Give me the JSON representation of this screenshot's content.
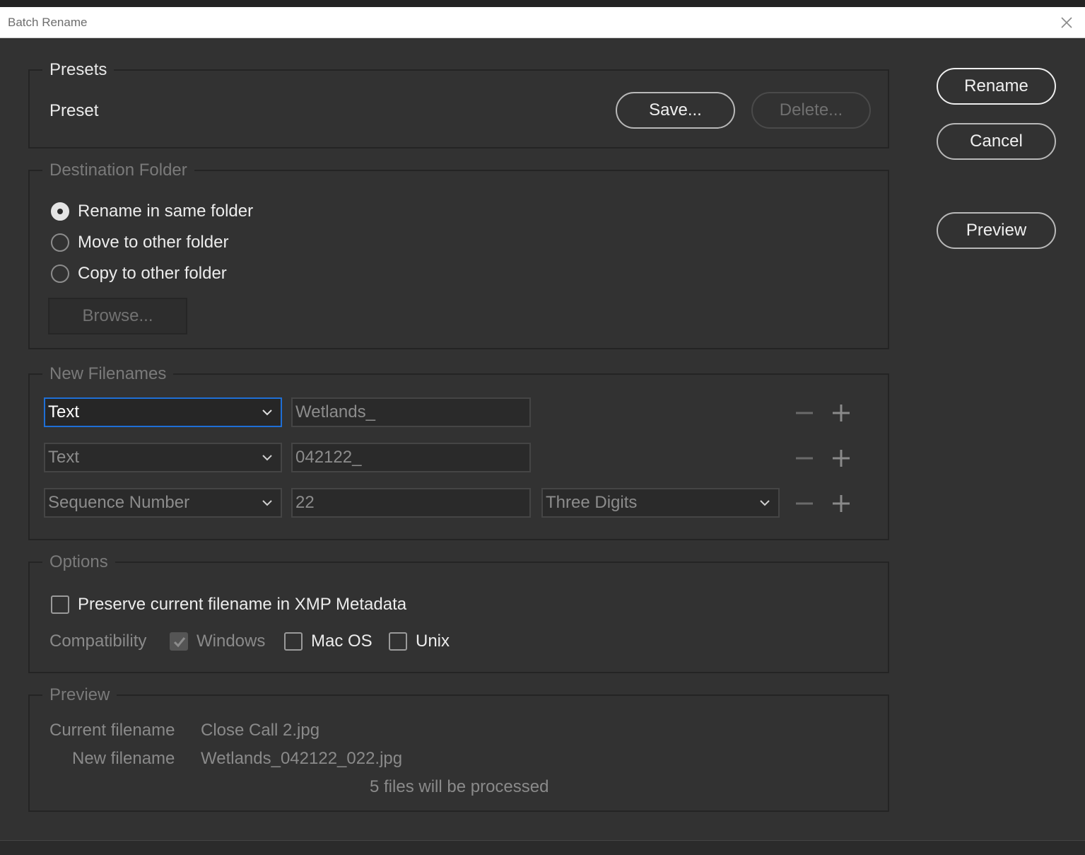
{
  "window": {
    "title": "Batch Rename"
  },
  "actions": {
    "rename": "Rename",
    "cancel": "Cancel",
    "preview": "Preview"
  },
  "presets": {
    "legend": "Presets",
    "preset_label": "Preset",
    "save": "Save...",
    "delete": "Delete..."
  },
  "destination": {
    "legend": "Destination Folder",
    "options": [
      "Rename in same folder",
      "Move to other folder",
      "Copy to other folder"
    ],
    "selected": "Rename in same folder",
    "browse": "Browse..."
  },
  "new_filenames": {
    "legend": "New Filenames",
    "rows": [
      {
        "type": "Text",
        "value": "Wetlands_"
      },
      {
        "type": "Text",
        "value": "042122_"
      },
      {
        "type": "Sequence Number",
        "value": "22",
        "format": "Three Digits"
      }
    ]
  },
  "options": {
    "legend": "Options",
    "preserve_label": "Preserve current filename in XMP Metadata",
    "preserve_checked": false,
    "compatibility_label": "Compatibility",
    "windows": "Windows",
    "windows_checked": true,
    "mac": "Mac OS",
    "mac_checked": false,
    "unix": "Unix",
    "unix_checked": false
  },
  "preview": {
    "legend": "Preview",
    "current_label": "Current filename",
    "current_value": "Close Call 2.jpg",
    "new_label": "New filename",
    "new_value": "Wetlands_042122_022.jpg",
    "summary": "5 files will be processed"
  },
  "icons": {
    "close": "close-icon",
    "chevron": "chevron-down-icon",
    "minus": "minus-icon",
    "plus": "plus-icon",
    "check": "checkmark-icon"
  },
  "colors": {
    "focus": "#1f6fd6",
    "background": "#323232"
  }
}
